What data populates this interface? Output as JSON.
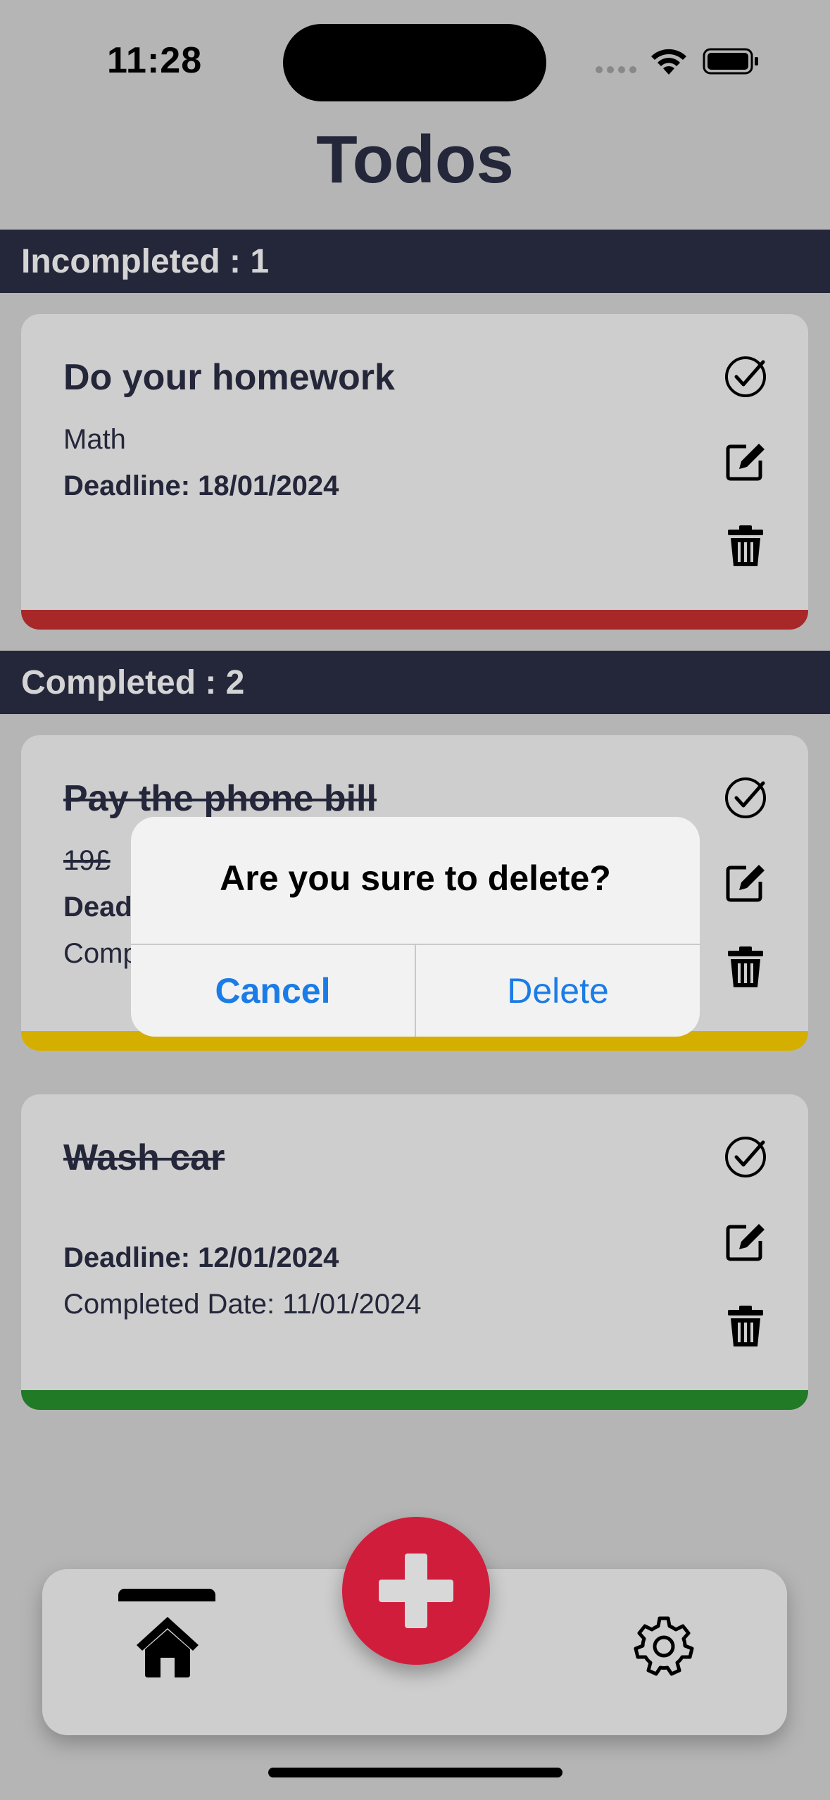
{
  "status_bar": {
    "time": "11:28"
  },
  "header": {
    "title": "Todos"
  },
  "sections": {
    "incompleted": {
      "label": "Incompleted : 1"
    },
    "completed": {
      "label": "Completed : 2"
    }
  },
  "todos": [
    {
      "title": "Do your homework",
      "note": "Math",
      "deadline": "Deadline: 18/01/2024",
      "stripe_color": "#a8282a"
    },
    {
      "title": "Pay the phone bill",
      "note": "19£",
      "deadline": "Deadline: 15/01/2024",
      "completed": "Completed Date: 14/01/2024",
      "stripe_color": "#d4af00"
    },
    {
      "title": "Wash car",
      "deadline": "Deadline: 12/01/2024",
      "completed": "Completed Date: 11/01/2024",
      "stripe_color": "#207a26"
    }
  ],
  "dialog": {
    "message": "Are you sure to delete?",
    "cancel_label": "Cancel",
    "delete_label": "Delete"
  },
  "icons": {
    "check": "check-circle-icon",
    "edit": "edit-icon",
    "delete": "trash-icon",
    "home": "home-icon",
    "settings": "gear-icon",
    "add": "plus-icon"
  },
  "colors": {
    "background": "#b5b5b5",
    "section_bar": "#24263a",
    "card": "#cecece",
    "fab": "#d11d3c",
    "dialog_action": "#1a7ce6"
  }
}
